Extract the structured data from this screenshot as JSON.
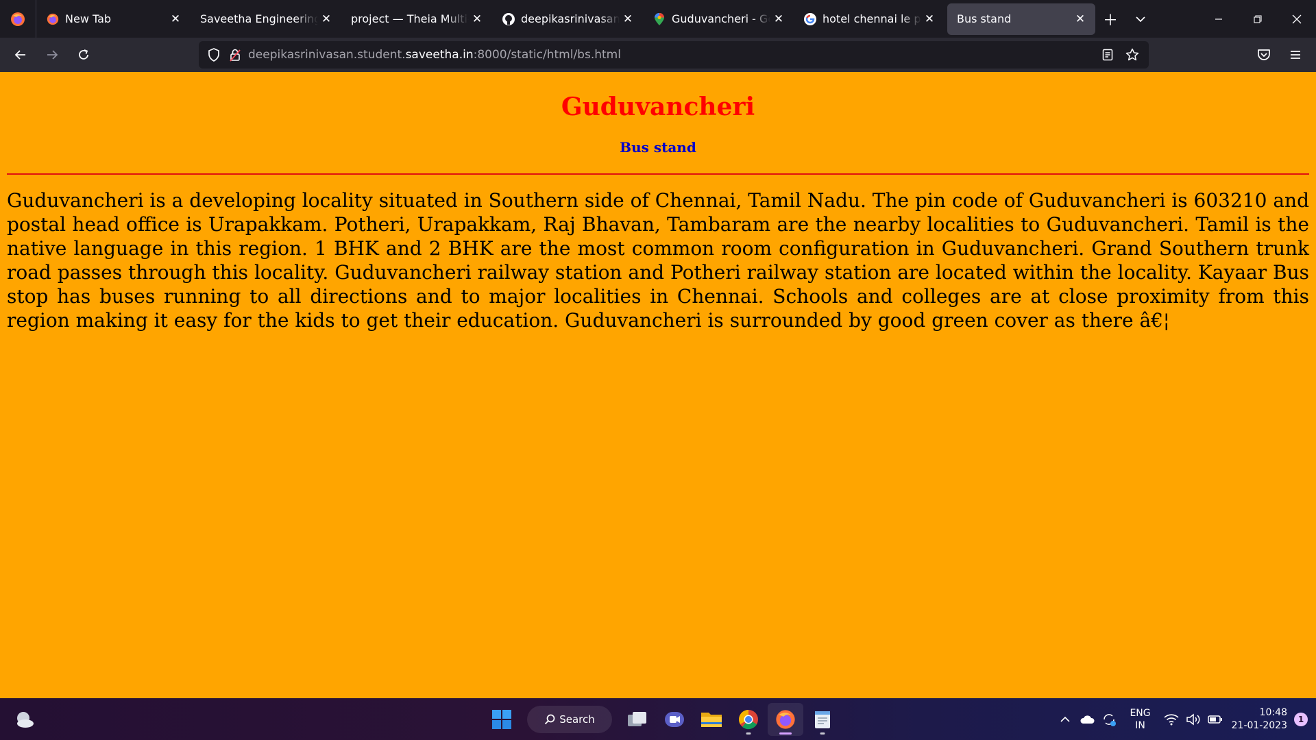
{
  "browser": {
    "tabs": [
      {
        "title": "New Tab",
        "favicon": "firefox-icon"
      },
      {
        "title": "Saveetha Engineering College",
        "favicon": "none"
      },
      {
        "title": "project — Theia Multi-Language",
        "favicon": "none"
      },
      {
        "title": "deepikasrinivasans/Ne",
        "favicon": "github-icon"
      },
      {
        "title": "Guduvancheri - Google Maps",
        "favicon": "maps-pin-icon"
      },
      {
        "title": "hotel chennai le palace",
        "favicon": "google-icon"
      },
      {
        "title": "Bus stand",
        "favicon": "none",
        "active": true
      }
    ],
    "url": {
      "prefix": "deepikasrinivasan.student.",
      "domain": "saveetha.in",
      "suffix": ":8000/static/html/bs.html"
    }
  },
  "page": {
    "heading": "Guduvancheri",
    "subheading": "Bus stand",
    "paragraph": "Guduvancheri is a developing locality situated in Southern side of Chennai, Tamil Nadu. The pin code of Guduvancheri is 603210 and postal head office is Urapakkam. Potheri, Urapakkam, Raj Bhavan, Tambaram are the nearby localities to Guduvancheri. Tamil is the native language in this region. 1 BHK and 2 BHK are the most common room configuration in Guduvancheri. Grand Southern trunk road passes through this locality. Guduvancheri railway station and Potheri railway station are located within the locality. Kayaar Bus stop has buses running to all directions and to major localities in Chennai. Schools and colleges are at close proximity from this region making it easy for the kids to get their education. Guduvancheri is surrounded by good green cover as there â€¦",
    "colors": {
      "background": "#ffa500",
      "heading": "#ff0000",
      "subheading": "#0000cc",
      "rule": "#e01010"
    }
  },
  "taskbar": {
    "search_label": "Search",
    "lang_line1": "ENG",
    "lang_line2": "IN",
    "time": "10:48",
    "date": "21-01-2023",
    "notification_count": "1"
  }
}
